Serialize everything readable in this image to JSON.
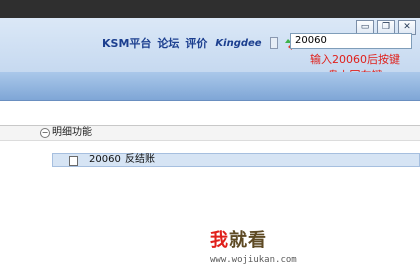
{
  "window_buttons": [
    "▭",
    "❐",
    "✕"
  ],
  "toolbar": {
    "links": [
      "KSM平台",
      "论坛",
      "评价"
    ],
    "brand": "Kingdee"
  },
  "search": {
    "value": "20060"
  },
  "hint": {
    "line1": "输入20060后按键",
    "line2": "盘上回车键"
  },
  "section": {
    "title": "明细功能",
    "toggle": "−"
  },
  "item": {
    "code": "20060",
    "name": "反结账"
  },
  "watermark": {
    "wo": "我",
    "rest": "就看",
    "url": "www.wojiukan.com"
  },
  "colors": {
    "accent_blue": "#1c3f8f",
    "hint_red": "#e0201b",
    "band_blue": "#7fa6d6"
  }
}
